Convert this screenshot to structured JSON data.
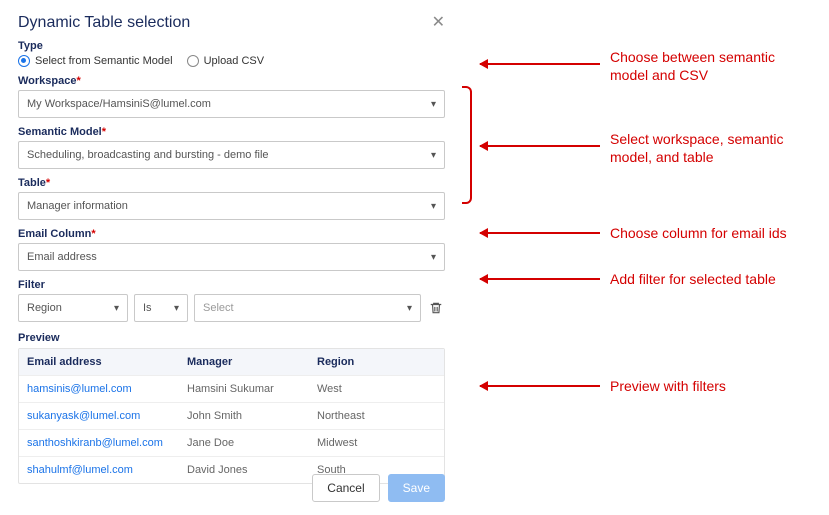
{
  "dialog": {
    "title": "Dynamic Table selection",
    "type_label": "Type",
    "radio_semantic": "Select from Semantic Model",
    "radio_csv": "Upload CSV",
    "workspace_label": "Workspace",
    "workspace_value": "My Workspace/HamsiniS@lumel.com",
    "semantic_label": "Semantic Model",
    "semantic_value": "Scheduling, broadcasting and bursting - demo file",
    "table_label": "Table",
    "table_value": "Manager information",
    "email_label": "Email Column",
    "email_value": "Email address",
    "filter_label": "Filter",
    "filter_field": "Region",
    "filter_op": "Is",
    "filter_val_placeholder": "Select",
    "preview_label": "Preview",
    "columns": [
      "Email address",
      "Manager",
      "Region"
    ],
    "rows": [
      {
        "email": "hamsinis@lumel.com",
        "manager": "Hamsini Sukumar",
        "region": "West"
      },
      {
        "email": "sukanyask@lumel.com",
        "manager": "John Smith",
        "region": "Northeast"
      },
      {
        "email": "santhoshkiranb@lumel.com",
        "manager": "Jane Doe",
        "region": "Midwest"
      },
      {
        "email": "shahulmf@lumel.com",
        "manager": "David Jones",
        "region": "South"
      }
    ],
    "cancel": "Cancel",
    "save": "Save"
  },
  "annotations": {
    "a1": "Choose between semantic\nmodel and CSV",
    "a2": "Select workspace, semantic\nmodel, and table",
    "a3": "Choose column for email ids",
    "a4": "Add filter for selected table",
    "a5": "Preview with filters"
  }
}
